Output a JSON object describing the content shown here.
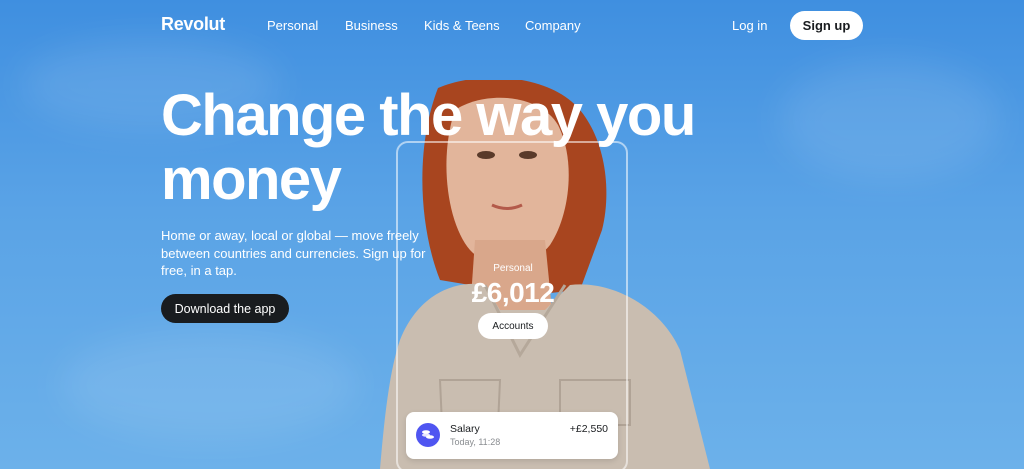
{
  "nav": {
    "logo": "Revolut",
    "links": [
      "Personal",
      "Business",
      "Kids & Teens",
      "Company"
    ],
    "login": "Log in",
    "signup": "Sign up"
  },
  "hero": {
    "headline_line1": "Change the way you",
    "headline_line2": "money",
    "subtitle": "Home or away, local or global — move freely between countries and currencies. Sign up for free, in a tap.",
    "cta": "Download the app"
  },
  "phone": {
    "account_label": "Personal",
    "balance": "£6,012",
    "accounts_button": "Accounts"
  },
  "transaction": {
    "title": "Salary",
    "time": "Today, 11:28",
    "amount": "+£2,550",
    "icon": "coins-icon"
  },
  "colors": {
    "sky": "#4f9be3",
    "dark_button": "#191c1f",
    "accent_purple": "#4f55f1"
  }
}
